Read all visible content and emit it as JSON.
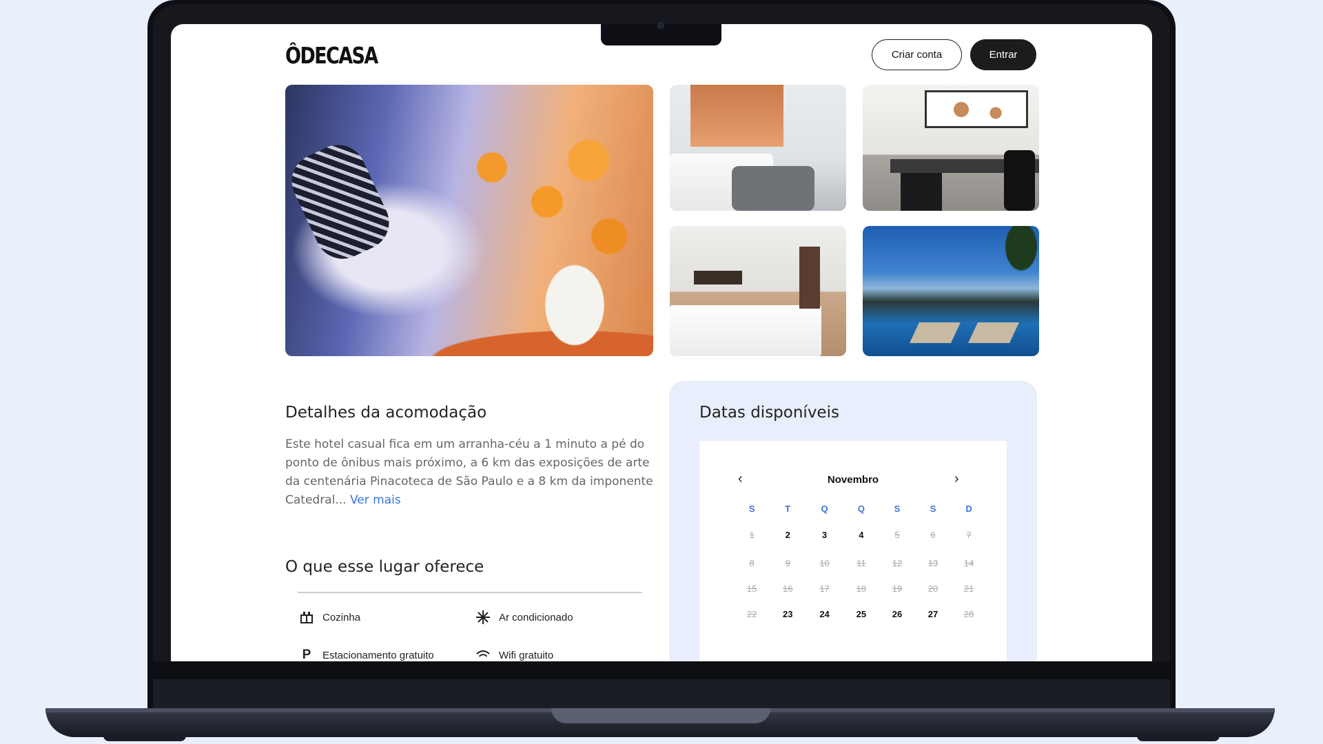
{
  "header": {
    "logo": "ÔDECASA",
    "create_account": "Criar conta",
    "login": "Entrar"
  },
  "details": {
    "title": "Detalhes da acomodação",
    "description": "Este hotel casual fica em um arranha-céu a 1 minuto a pé do ponto de ônibus mais próximo, a 6 km das exposições de arte da centenária Pinacoteca de São Paulo e a 8 km da imponente Catedral...",
    "more_link": "Ver mais"
  },
  "offers": {
    "title": "O que esse lugar oferece",
    "items": [
      {
        "label": "Cozinha",
        "icon": "kitchen-icon"
      },
      {
        "label": "Ar condicionado",
        "icon": "snowflake-icon"
      },
      {
        "label": "Estacionamento gratuito",
        "icon": "parking-icon"
      },
      {
        "label": "Wifi gratuito",
        "icon": "wifi-icon"
      }
    ]
  },
  "dates": {
    "title": "Datas disponíveis",
    "month": "Novembro",
    "weekdays": [
      "S",
      "T",
      "Q",
      "Q",
      "S",
      "S",
      "D"
    ],
    "weeks": [
      [
        {
          "d": "1",
          "a": false
        },
        {
          "d": "2",
          "a": true
        },
        {
          "d": "3",
          "a": true
        },
        {
          "d": "4",
          "a": true
        },
        {
          "d": "5",
          "a": false
        },
        {
          "d": "6",
          "a": false
        },
        {
          "d": "7",
          "a": false
        }
      ],
      [
        {
          "d": "8",
          "a": false
        },
        {
          "d": "9",
          "a": false
        },
        {
          "d": "10",
          "a": false
        },
        {
          "d": "11",
          "a": false
        },
        {
          "d": "12",
          "a": false
        },
        {
          "d": "13",
          "a": false
        },
        {
          "d": "14",
          "a": false
        }
      ],
      [
        {
          "d": "15",
          "a": false
        },
        {
          "d": "16",
          "a": false
        },
        {
          "d": "17",
          "a": false
        },
        {
          "d": "18",
          "a": false
        },
        {
          "d": "19",
          "a": false
        },
        {
          "d": "20",
          "a": false
        },
        {
          "d": "21",
          "a": false
        }
      ],
      [
        {
          "d": "22",
          "a": false
        },
        {
          "d": "23",
          "a": true
        },
        {
          "d": "24",
          "a": true
        },
        {
          "d": "25",
          "a": true
        },
        {
          "d": "26",
          "a": true
        },
        {
          "d": "27",
          "a": true
        },
        {
          "d": "28",
          "a": false
        }
      ]
    ]
  },
  "colors": {
    "accent": "#3b73d9",
    "dark_button": "#1c1c1c",
    "dates_panel": "#e8eefb",
    "background": "#e9f0fc"
  }
}
